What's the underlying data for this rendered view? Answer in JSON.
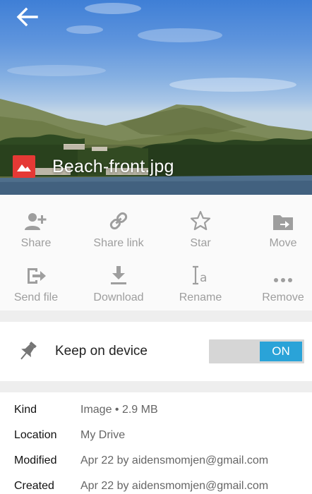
{
  "colors": {
    "accent": "#2aa3d8",
    "file_icon_bg": "#e53935",
    "action_gray": "#9e9e9e"
  },
  "header": {
    "back_icon": "arrow-left-icon",
    "file_type_icon": "image-file-icon",
    "file_name": "Beach-front.jpg"
  },
  "actions": [
    {
      "label": "Share",
      "icon": "add-person-icon"
    },
    {
      "label": "Share link",
      "icon": "link-icon"
    },
    {
      "label": "Star",
      "icon": "star-outline-icon"
    },
    {
      "label": "Move",
      "icon": "move-folder-icon"
    },
    {
      "label": "Send file",
      "icon": "send-file-icon"
    },
    {
      "label": "Download",
      "icon": "download-icon"
    },
    {
      "label": "Rename",
      "icon": "rename-icon"
    },
    {
      "label": "Remove",
      "icon": "more-dots-icon"
    }
  ],
  "keep_on_device": {
    "icon": "pin-icon",
    "label": "Keep on device",
    "toggle_label": "ON",
    "enabled": true
  },
  "details": [
    {
      "key": "Kind",
      "value": "Image • 2.9 MB"
    },
    {
      "key": "Location",
      "value": "My Drive"
    },
    {
      "key": "Modified",
      "value": "Apr 22 by aidensmomjen@gmail.com"
    },
    {
      "key": "Created",
      "value": "Apr 22 by aidensmomjen@gmail.com"
    }
  ]
}
